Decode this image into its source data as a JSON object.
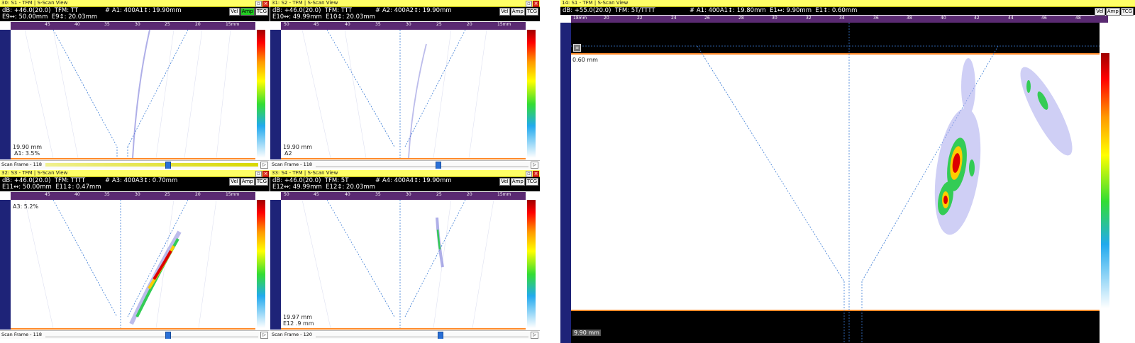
{
  "panels": [
    {
      "title": "30: S1 - TFM | S-Scan View",
      "info_line1": "dB: +46.0(20.0)  TFM: TT",
      "info_line2": "E9↔: 50.00mm  E9↕: 20.03mm",
      "info_a": "# A1: 400A1↕: 19.90mm",
      "modes": [
        "Vel",
        "Amp",
        "TCG"
      ],
      "ruler_labels": [
        "45",
        "40",
        "35",
        "30",
        "25",
        "20",
        "15mm"
      ],
      "overlay_top": "",
      "overlay_bottom1": "19.90 mm",
      "overlay_bottom2": "A1: 3.5%",
      "scan_label": "Scan Frame - 118"
    },
    {
      "title": "31: S2 - TFM | S-Scan View",
      "info_line1": "dB: +46.0(20.0)  TFM: TTT",
      "info_line2": "E10↔: 49.99mm  E10↕: 20.03mm",
      "info_a": "# A2: 400A2↕: 19.90mm",
      "modes": [
        "Vel",
        "Amp",
        "TCG"
      ],
      "ruler_labels": [
        "50",
        "45",
        "40",
        "35",
        "30",
        "25",
        "20",
        "15mm"
      ],
      "overlay_top": "",
      "overlay_bottom1": "19.90 mm",
      "overlay_bottom2": "A2",
      "scan_label": "Scan Frame - 118"
    },
    {
      "title": "32: S3 - TFM | S-Scan View",
      "info_line1": "dB: +46.0(20.0)  TFM: TTTT",
      "info_line2": "E11↔: 50.00mm  E11↕: 0.47mm",
      "info_a": "# A3: 400A3↕: 0.70mm",
      "modes": [
        "Vel",
        "Amp",
        "TCG"
      ],
      "ruler_labels": [
        "45",
        "40",
        "35",
        "30",
        "25",
        "20",
        "15mm"
      ],
      "overlay_top": "A3: 5.2%",
      "overlay_bottom1": "",
      "overlay_bottom2": "",
      "scan_label": "Scan Frame - 118"
    },
    {
      "title": "33: S4 - TFM | S-Scan View",
      "info_line1": "dB: +46.0(20.0)  TFM: 5T",
      "info_line2": "E12↔: 49.99mm  E12↕: 20.03mm",
      "info_a": "# A4: 400A4↕: 19.90mm",
      "modes": [
        "Vel",
        "Amp",
        "TCG"
      ],
      "ruler_labels": [
        "50",
        "45",
        "40",
        "35",
        "30",
        "25",
        "20",
        "15mm"
      ],
      "overlay_top": "",
      "overlay_bottom1": "19.97 mm",
      "overlay_bottom2": "E12 .9 mm",
      "scan_label": "Scan Frame - 120"
    },
    {
      "title": "14: S1 - TFM | S-Scan View",
      "info_line1": "dB: +55.0(20.0)  TFM: 5T/TTTT",
      "info_line2": "",
      "info_a": "# A1: 400A1↕: 19.80mm  E1↔: 9.90mm  E1↕: 0.60mm",
      "modes": [
        "Vel",
        "Amp",
        "TCG"
      ],
      "ruler_labels": [
        "18mm",
        "20",
        "22",
        "24",
        "26",
        "28",
        "30",
        "32",
        "34",
        "36",
        "38",
        "40",
        "42",
        "44",
        "46",
        "48"
      ],
      "overlay_top": "0.60 mm",
      "overlay_bottom1": "9.90 mm",
      "overlay_bottom2": "",
      "scan_label": ""
    }
  ],
  "colors": {
    "titlebar": "#ffff66",
    "infobar": "#000000",
    "ruler": "#5a2a72",
    "vruler": "#1e2378",
    "gate_line": "#ff8a2a",
    "cursor": "#2a6fd6"
  }
}
